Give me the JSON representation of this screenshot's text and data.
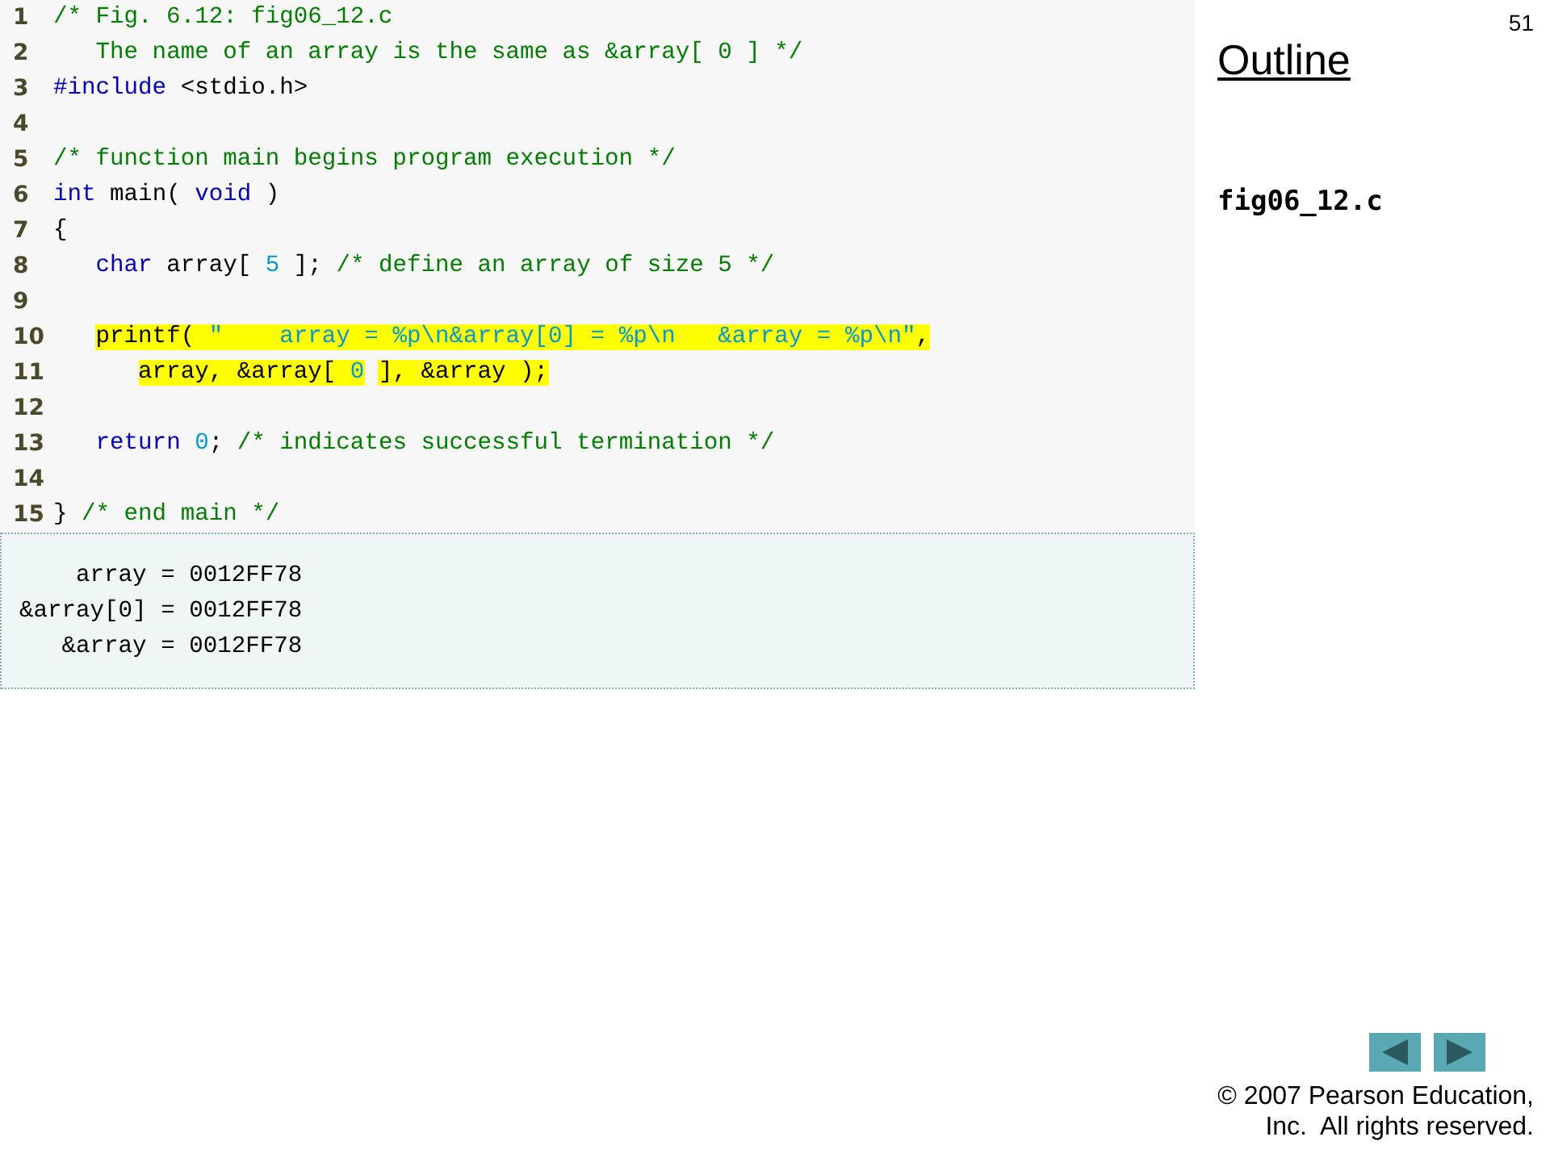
{
  "code": {
    "lines": [
      {
        "number": "1",
        "highlighted": false,
        "tokens": [
          {
            "kind": "comment",
            "text": "/* Fig. 6.12: fig06_12.c"
          }
        ]
      },
      {
        "number": "2",
        "highlighted": false,
        "tokens": [
          {
            "kind": "comment",
            "text": "   The name of an array is the same as &array[ 0 ] */"
          }
        ]
      },
      {
        "number": "3",
        "highlighted": false,
        "tokens": [
          {
            "kind": "keyword",
            "text": "#include"
          },
          {
            "kind": "plain",
            "text": " <stdio.h>"
          }
        ]
      },
      {
        "number": "4"
      },
      {
        "number": "5",
        "highlighted": false,
        "tokens": [
          {
            "kind": "comment",
            "text": "/* function main begins program execution */"
          }
        ]
      },
      {
        "number": "6",
        "highlighted": false,
        "tokens": [
          {
            "kind": "keyword",
            "text": "int"
          },
          {
            "kind": "plain",
            "text": " main( "
          },
          {
            "kind": "keyword",
            "text": "void"
          },
          {
            "kind": "plain",
            "text": " )"
          }
        ]
      },
      {
        "number": "7",
        "highlighted": false,
        "tokens": [
          {
            "kind": "plain",
            "text": "{"
          }
        ]
      },
      {
        "number": "8",
        "highlighted": false,
        "tokens": [
          {
            "kind": "keyword",
            "text": "   char"
          },
          {
            "kind": "plain",
            "text": " array[ "
          },
          {
            "kind": "number",
            "text": "5"
          },
          {
            "kind": "plain",
            "text": " ]; "
          },
          {
            "kind": "comment",
            "text": "/* define an array of size 5 */"
          }
        ]
      },
      {
        "number": "9"
      },
      {
        "number": "10",
        "highlighted": true,
        "tokens": [
          {
            "kind": "plain",
            "text": "   printf( "
          },
          {
            "kind": "string",
            "text": "\"    array = %p\\n&array[0] = %p\\n   &array = %p\\n\""
          },
          {
            "kind": "plain",
            "text": ","
          }
        ]
      },
      {
        "number": "11",
        "highlighted": true,
        "tokens": [
          {
            "kind": "plain",
            "text": "      array, &array[ "
          },
          {
            "kind": "number",
            "text": "0"
          },
          {
            "kind": "plain",
            "text": " ], &array );"
          }
        ]
      },
      {
        "number": "12"
      },
      {
        "number": "13",
        "highlighted": false,
        "tokens": [
          {
            "kind": "keyword",
            "text": "   return "
          },
          {
            "kind": "number",
            "text": "0"
          },
          {
            "kind": "plain",
            "text": "; "
          },
          {
            "kind": "comment",
            "text": "/* indicates successful termination */"
          }
        ]
      },
      {
        "number": "14"
      },
      {
        "number": "15",
        "highlighted": false,
        "tokens": [
          {
            "kind": "plain",
            "text": "} "
          },
          {
            "kind": "comment",
            "text": "/* end main */"
          }
        ]
      }
    ]
  },
  "output": {
    "lines": [
      "    array = 0012FF78",
      "&array[0] = 0012FF78",
      "   &array = 0012FF78"
    ]
  },
  "slide_number": "51",
  "outline": {
    "title": "Outline",
    "file": "fig06_12.c"
  },
  "nav": {
    "buttons": [
      {
        "kind": "previous"
      },
      {
        "kind": "next"
      }
    ]
  },
  "copyright": [
    "© 2007 Pearson Education,",
    "Inc.  All rights reserved."
  ]
}
